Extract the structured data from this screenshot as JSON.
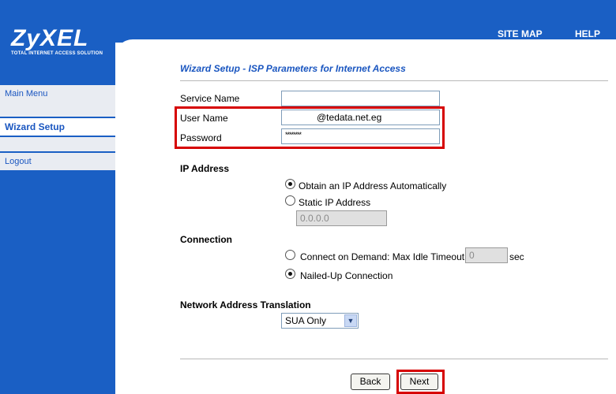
{
  "header": {
    "links": [
      "SITE MAP",
      "HELP"
    ]
  },
  "logo": {
    "name": "ZyXEL",
    "tagline": "TOTAL INTERNET ACCESS SOLUTION"
  },
  "sidebar": {
    "items": [
      {
        "label": "Main Menu",
        "active": false
      },
      {
        "label": "Wizard Setup",
        "active": true
      },
      {
        "label": "Logout",
        "active": false
      }
    ]
  },
  "main": {
    "title": "Wizard Setup - ISP Parameters for Internet Access",
    "fields": {
      "service_name": {
        "label": "Service Name",
        "value": ""
      },
      "user_name": {
        "label": "User Name",
        "value": "@tedata.net.eg"
      },
      "password": {
        "label": "Password",
        "value": "********"
      }
    },
    "ip_address": {
      "title": "IP Address",
      "option_auto": "Obtain an IP Address Automatically",
      "option_static": "Static IP Address",
      "static_value": "0.0.0.0",
      "selected": "auto"
    },
    "connection": {
      "title": "Connection",
      "option_demand": "Connect on Demand: Max Idle Timeout",
      "timeout_value": "0",
      "timeout_unit": "sec",
      "option_nailed": "Nailed-Up Connection",
      "selected": "nailed"
    },
    "nat": {
      "title": "Network Address Translation",
      "selected": "SUA Only"
    },
    "buttons": {
      "back": "Back",
      "next": "Next"
    }
  },
  "colors": {
    "brand_blue": "#1a5fc4",
    "link_blue": "#1a56c0",
    "highlight_red": "#d60000"
  }
}
